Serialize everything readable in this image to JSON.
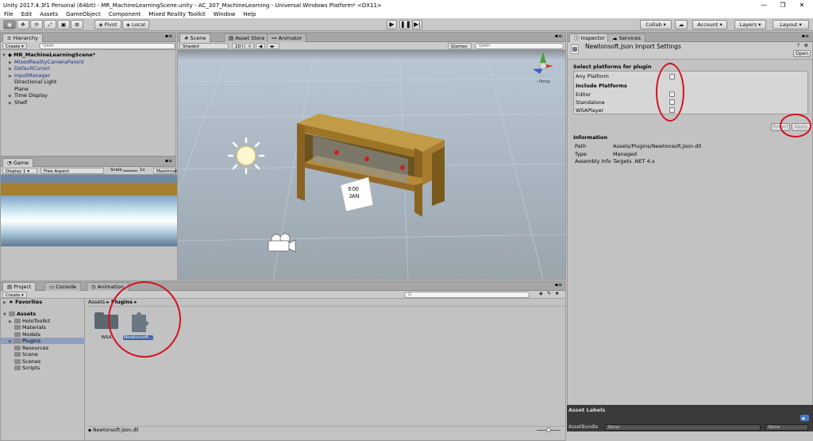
{
  "window": {
    "title": "Unity 2017.4.3f1 Personal (64bit) - MR_MachineLearningScene.unity - AC_307_MachineLearning - Universal Windows Platform* <DX11>",
    "controls": [
      "—",
      "❐",
      "✕"
    ]
  },
  "menu": [
    "File",
    "Edit",
    "Assets",
    "GameObject",
    "Component",
    "Mixed Reality Toolkit",
    "Window",
    "Help"
  ],
  "toolbar": {
    "pivot": "Pivot",
    "local": "Local",
    "collab": "Collab ▾",
    "account": "Account ▾",
    "layers": "Layers ▾",
    "layout": "Layout ▾",
    "cloud": "☁"
  },
  "hierarchy": {
    "tab": "Hierarchy",
    "create": "Create ▾",
    "search_placeholder": "Q▾All",
    "scene": "MR_MachineLearningScene*",
    "items": [
      {
        "label": "MixedRealityCameraParent",
        "blue": true,
        "arrow": true
      },
      {
        "label": "DefaultCursor",
        "blue": true,
        "arrow": true
      },
      {
        "label": "InputManager",
        "blue": true,
        "arrow": true
      },
      {
        "label": "Directional Light",
        "blue": false,
        "arrow": false
      },
      {
        "label": "Plane",
        "blue": false,
        "arrow": false
      },
      {
        "label": "Time Display",
        "blue": false,
        "arrow": true
      },
      {
        "label": "Shelf",
        "blue": false,
        "arrow": true
      }
    ]
  },
  "game": {
    "tab": "Game",
    "display": "Display 1 ▾",
    "aspect": "Free Aspect",
    "scale_label": "Scale",
    "scale_value": "1x",
    "maximize": "Maximize"
  },
  "scene_view": {
    "tabs": [
      "Scene",
      "Asset Store",
      "Animator"
    ],
    "shaded": "Shaded",
    "twod": "2D",
    "gizmos": "Gizmos ▾",
    "search_placeholder": "Q▾All",
    "clock_line1": "9:00",
    "clock_line2": "JAN",
    "persp": "‹ Persp"
  },
  "inspector": {
    "tabs": [
      "Inspector",
      "Services"
    ],
    "title": "Newtonsoft.Json Import Settings",
    "open": "Open",
    "select_header": "Select platforms for plugin",
    "any_platform": "Any Platform",
    "include_header": "Include Platforms",
    "platforms": [
      "Editor",
      "Standalone",
      "WSAPlayer"
    ],
    "revert": "Revert",
    "apply": "Apply",
    "info_header": "Information",
    "info": [
      {
        "key": "Path",
        "value": "Assets/Plugins/Newtonsoft.Json.dll"
      },
      {
        "key": "Type",
        "value": "Managed"
      },
      {
        "key": "Assembly Info",
        "value": "Targets .NET 4.x"
      }
    ],
    "asset_labels": "Asset Labels",
    "asset_bundle": "AssetBundle",
    "none1": "None",
    "none2": "None"
  },
  "project": {
    "tabs": [
      "Project",
      "Console",
      "Animation"
    ],
    "create": "Create ▾",
    "favorites": "Favorites",
    "assets": "Assets",
    "tree": [
      "HoloToolkit",
      "Materials",
      "Models",
      "Plugins",
      "Resources",
      "Scene",
      "Scenes",
      "Scripts"
    ],
    "breadcrumb_root": "Assets ▸",
    "breadcrumb_leaf": "Plugins ▸",
    "files": [
      "WSA",
      "Newtonsoft..."
    ],
    "status_file": "Newtonsoft.Json.dll"
  },
  "colors": {
    "annotation": "#d4121f",
    "shelf": "#a77a2c",
    "selection": "#8e9fc1"
  }
}
